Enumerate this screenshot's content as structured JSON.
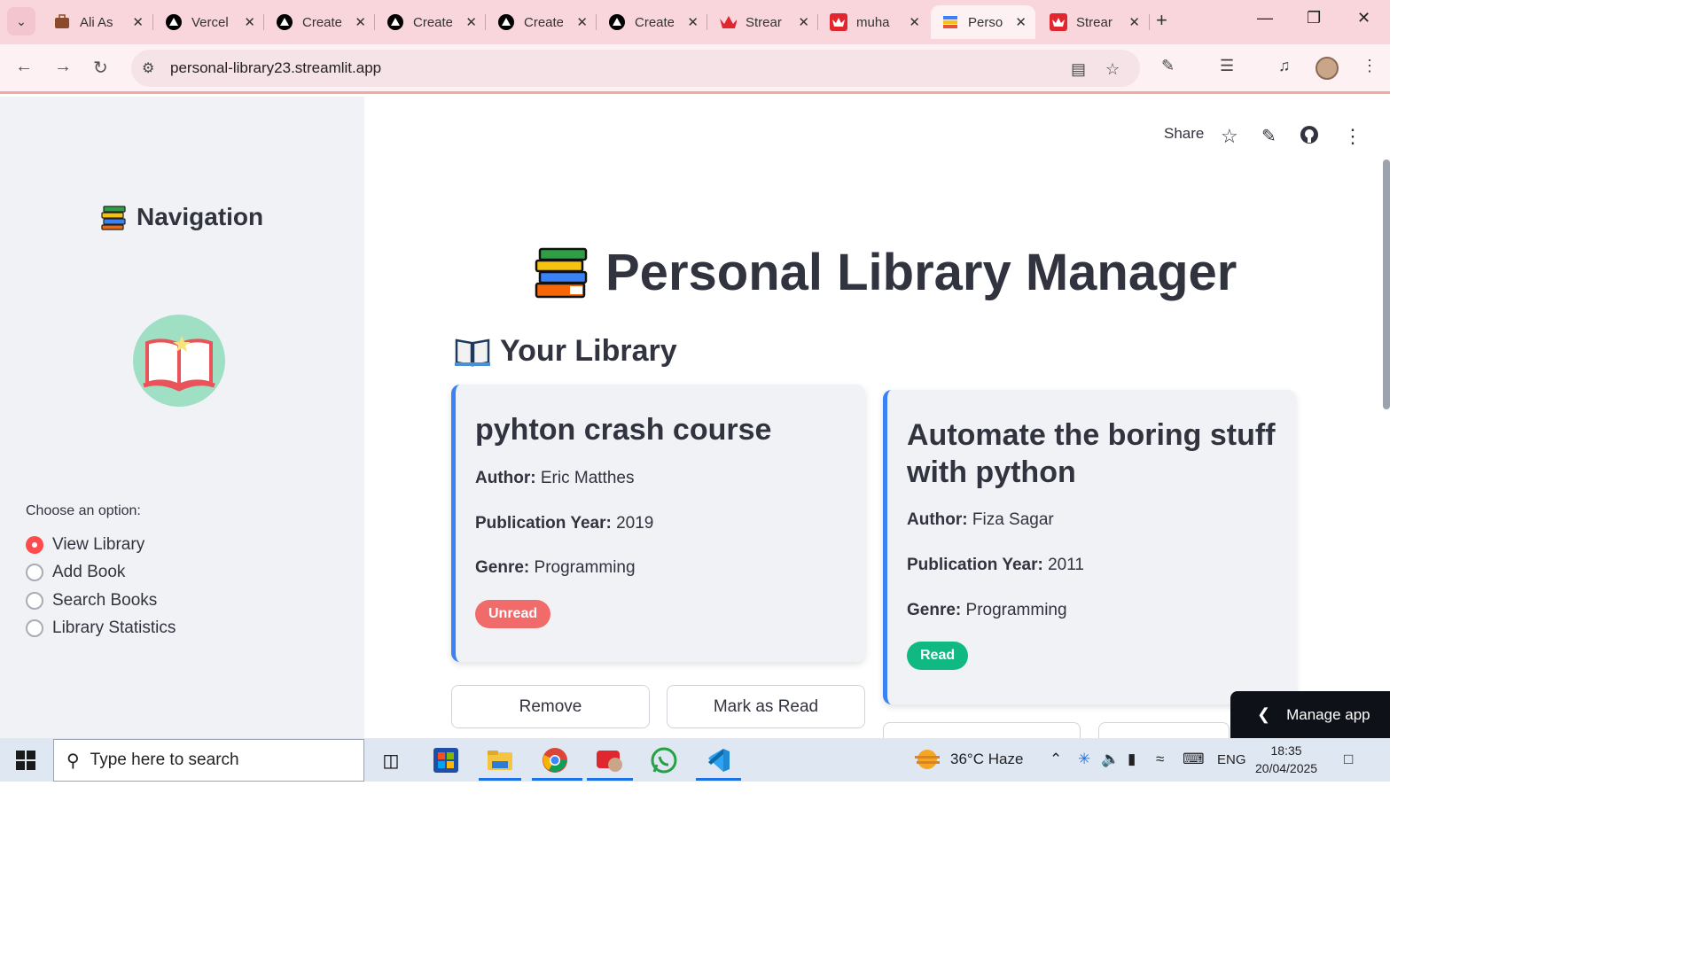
{
  "browser": {
    "tabs": [
      {
        "label": "Ali As",
        "icon": "briefcase-icon"
      },
      {
        "label": "Vercel",
        "icon": "vercel-icon"
      },
      {
        "label": "Create",
        "icon": "vercel-icon"
      },
      {
        "label": "Create",
        "icon": "vercel-icon"
      },
      {
        "label": "Create",
        "icon": "vercel-icon"
      },
      {
        "label": "Create",
        "icon": "vercel-icon"
      },
      {
        "label": "Strear",
        "icon": "streamlit-icon"
      },
      {
        "label": "muha",
        "icon": "streamlit-icon"
      },
      {
        "label": "Perso",
        "icon": "books-icon",
        "active": true
      },
      {
        "label": "Strear",
        "icon": "streamlit-icon"
      }
    ],
    "url": "personal-library23.streamlit.app"
  },
  "sidebar": {
    "title": "Navigation",
    "radio_label": "Choose an option:",
    "options": [
      {
        "label": "View Library",
        "selected": true
      },
      {
        "label": "Add Book",
        "selected": false
      },
      {
        "label": "Search Books",
        "selected": false
      },
      {
        "label": "Library Statistics",
        "selected": false
      }
    ]
  },
  "header": {
    "share": "Share"
  },
  "main": {
    "title": "Personal Library Manager",
    "section": "Your Library",
    "books": [
      {
        "title": "pyhton crash course",
        "author_label": "Author:",
        "author": "Eric Matthes",
        "year_label": "Publication Year:",
        "year": "2019",
        "genre_label": "Genre:",
        "genre": "Programming",
        "status": "Unread",
        "remove_label": "Remove",
        "toggle_label": "Mark as Read"
      },
      {
        "title": "Automate the boring stuff with python",
        "author_label": "Author:",
        "author": "Fiza Sagar",
        "year_label": "Publication Year:",
        "year": "2011",
        "genre_label": "Genre:",
        "genre": "Programming",
        "status": "Read"
      }
    ],
    "manage_app": "Manage app"
  },
  "taskbar": {
    "search_placeholder": "Type here to search",
    "weather": "36°C  Haze",
    "language": "ENG",
    "time": "18:35",
    "date": "20/04/2025"
  },
  "colors": {
    "accent": "#ff4b4b",
    "card_border": "#3b82f6",
    "unread": "#f26b6b",
    "read": "#10b981",
    "tabstrip": "#f9d5dc"
  }
}
